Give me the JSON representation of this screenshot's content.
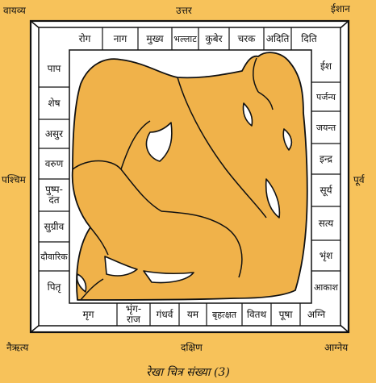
{
  "directions": {
    "northwest": "वायव्य",
    "north": "उत्तर",
    "northeast": "ईशान",
    "west": "पश्चिम",
    "east": "पूर्व",
    "southwest": "नैऋत्य",
    "south": "दक्षिण",
    "southeast": "आग्नेय"
  },
  "top_row": [
    "रोग",
    "नाग",
    "मुख्य",
    "भल्लाट",
    "कुबेर",
    "चरक",
    "अदिति",
    "दिति"
  ],
  "bottom_row": [
    "मृग",
    "भृंग-\nराज",
    "गंधर्व",
    "यम",
    "बृहत्क्षत",
    "वितथ",
    "पूषा",
    "अग्नि"
  ],
  "left_col": [
    "पाप",
    "शेष",
    "असुर",
    "वरुण",
    "पुष्प-\nदंत",
    "सुग्रीव",
    "दौवारिक",
    "पितृ"
  ],
  "right_col": [
    "ईश",
    "पर्जन्य",
    "जयन्त",
    "इन्द्र",
    "सूर्य",
    "सत्य",
    "भृंश",
    "आकाश"
  ],
  "caption": "रेखा चित्र संख्या (3)",
  "colors": {
    "background": "#f7c25a",
    "figure": "#f0b24a",
    "cell": "#ffffff",
    "line": "#111111"
  }
}
